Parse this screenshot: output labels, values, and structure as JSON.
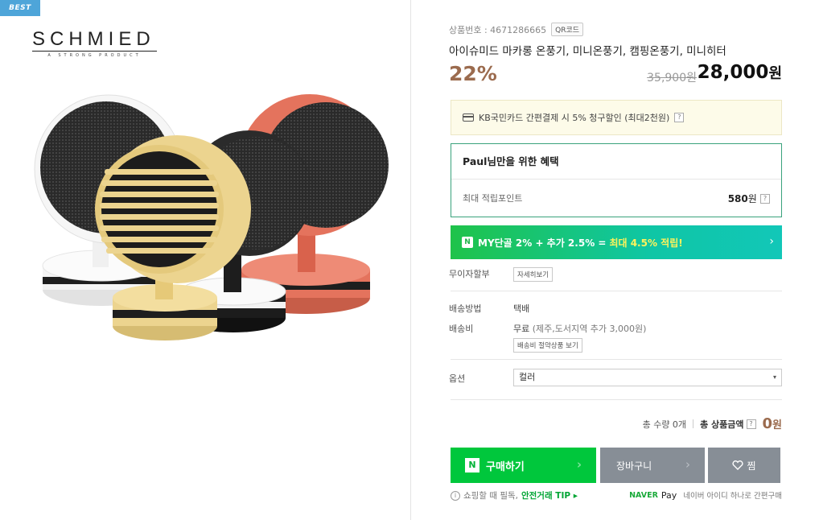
{
  "badge": "BEST",
  "brand": {
    "name": "SCHMIED",
    "tagline": "A STRONG PRODUCT"
  },
  "product": {
    "number_label": "상품번호 : 4671286665",
    "qr_label": "QR코드",
    "title": "아이슈미드 마카롱 온풍기, 미니온풍기, 캠핑온풍기, 미니히터",
    "discount": "22%",
    "original_price": "35,900원",
    "sale_price": "28,000",
    "sale_currency": "원"
  },
  "card_promo": {
    "text": "KB국민카드 간편결제 시 5% 청구할인 (최대2천원)",
    "help": "?"
  },
  "benefit": {
    "title": "Paul님만을 위한 혜택",
    "row_label": "최대 적립포인트",
    "points": "580",
    "points_unit": "원",
    "help": "?"
  },
  "my_banner": {
    "n": "N",
    "text": "MY단골 2% + 추가 2.5% =",
    "highlight": "최대 4.5% 적립!",
    "chevron": "›"
  },
  "installment": {
    "label": "무이자할부",
    "button": "자세히보기"
  },
  "delivery": {
    "method_label": "배송방법",
    "method_value": "택배",
    "fee_label": "배송비",
    "fee_value": "무료",
    "fee_note": "(제주,도서지역 추가 3,000원)",
    "bundle_button": "배송비 절약상품 보기"
  },
  "option": {
    "label": "옵션",
    "selected": "컬러",
    "arrow": "▾"
  },
  "totals": {
    "qty_label": "총 수량 0개",
    "amount_label": "총 상품금액",
    "help": "?",
    "amount": "0",
    "unit": "원"
  },
  "buttons": {
    "buy_n": "N",
    "buy": "구매하기",
    "cart": "장바구니",
    "wish": "찜",
    "arrow": "›"
  },
  "tip": {
    "icon": "i",
    "text": "쇼핑할 때 필독,",
    "safe": "안전거래 TIP ▸"
  },
  "npay": {
    "naver": "NAVER",
    "pay": "Pay",
    "text": "네이버 아이디 하나로 간편구매"
  },
  "colors": {
    "accent_green": "#00c73c",
    "discount_brown": "#9b6b4e",
    "button_gray": "#878e96",
    "badge_blue": "#4ea5d9",
    "heater_white": "#f2f2f2",
    "heater_black": "#222222",
    "heater_yellow": "#ecd48f",
    "heater_coral": "#e4735d"
  }
}
